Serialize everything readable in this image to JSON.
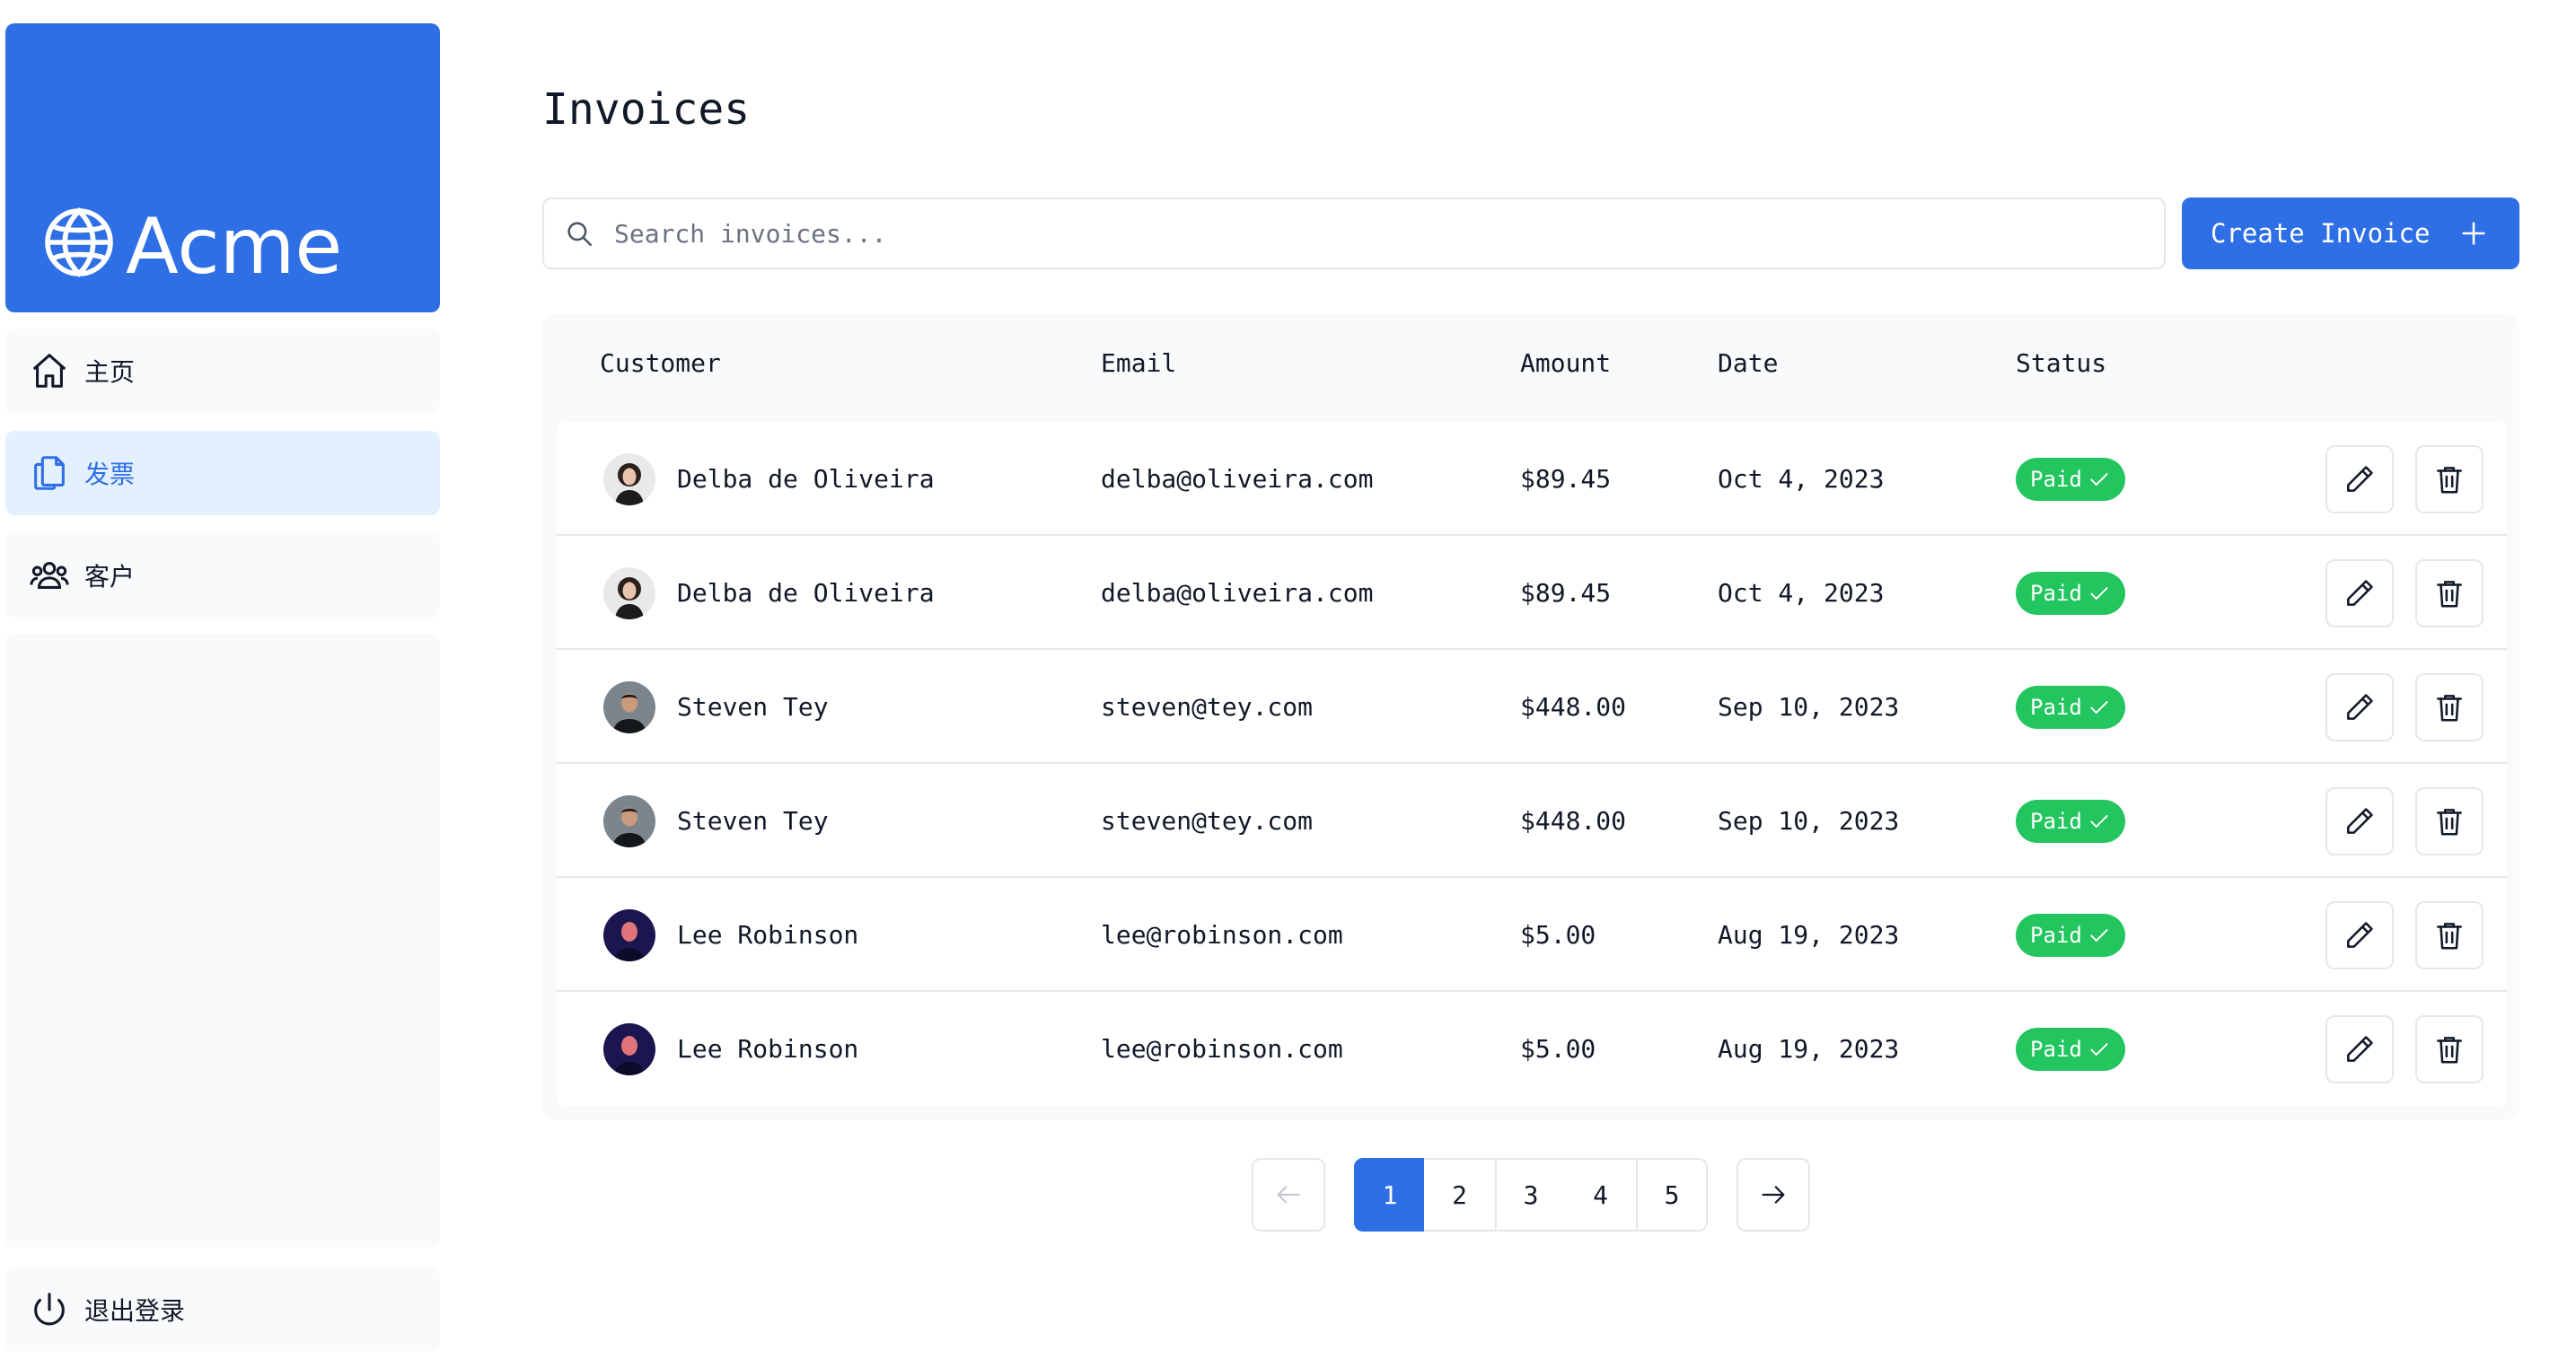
{
  "brand": {
    "name": "Acme",
    "icon": "globe-icon",
    "color": "#2f6fe6"
  },
  "sidebar": {
    "items": [
      {
        "label": "主页",
        "icon": "home-icon"
      },
      {
        "label": "发票",
        "icon": "document-icon",
        "active": true
      },
      {
        "label": "客户",
        "icon": "users-icon"
      }
    ],
    "signout": {
      "label": "退出登录",
      "icon": "power-icon"
    }
  },
  "page": {
    "title": "Invoices"
  },
  "search": {
    "placeholder": "Search invoices...",
    "value": ""
  },
  "create_button": {
    "label": "Create Invoice",
    "icon": "plus-icon"
  },
  "table": {
    "columns": [
      "Customer",
      "Email",
      "Amount",
      "Date",
      "Status"
    ],
    "rows": [
      {
        "name": "Delba de Oliveira",
        "email": "delba@oliveira.com",
        "amount": "$89.45",
        "date": "Oct 4, 2023",
        "status": "Paid"
      },
      {
        "name": "Delba de Oliveira",
        "email": "delba@oliveira.com",
        "amount": "$89.45",
        "date": "Oct 4, 2023",
        "status": "Paid"
      },
      {
        "name": "Steven Tey",
        "email": "steven@tey.com",
        "amount": "$448.00",
        "date": "Sep 10, 2023",
        "status": "Paid"
      },
      {
        "name": "Steven Tey",
        "email": "steven@tey.com",
        "amount": "$448.00",
        "date": "Sep 10, 2023",
        "status": "Paid"
      },
      {
        "name": "Lee Robinson",
        "email": "lee@robinson.com",
        "amount": "$5.00",
        "date": "Aug 19, 2023",
        "status": "Paid"
      },
      {
        "name": "Lee Robinson",
        "email": "lee@robinson.com",
        "amount": "$5.00",
        "date": "Aug 19, 2023",
        "status": "Paid"
      }
    ]
  },
  "pagination": {
    "pages": [
      "1",
      "2",
      "3",
      "4",
      "5"
    ],
    "current": "1",
    "prev_icon": "arrow-left-icon",
    "next_icon": "arrow-right-icon"
  },
  "colors": {
    "accent": "#2f6fe6",
    "paid": "#22c55e",
    "active_nav_bg": "#e3f0fd"
  }
}
